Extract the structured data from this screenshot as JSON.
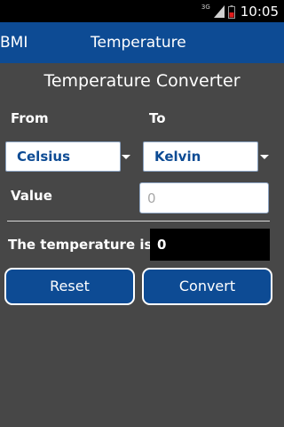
{
  "status_bar": {
    "network": "3G",
    "time": "10:05",
    "signal_icon": "signal-bars-icon",
    "battery_icon": "battery-low-icon",
    "battery_color": "#e11b1b"
  },
  "tabs": [
    {
      "label": "BMI"
    },
    {
      "label": "Temperature"
    }
  ],
  "title": "Temperature Converter",
  "from": {
    "label": "From",
    "selected": "Celsius"
  },
  "to": {
    "label": "To",
    "selected": "Kelvin"
  },
  "value": {
    "label": "Value",
    "placeholder": "0",
    "current": ""
  },
  "result": {
    "label": "The temperature is",
    "value": "0"
  },
  "buttons": {
    "reset": "Reset",
    "convert": "Convert"
  },
  "colors": {
    "accent": "#0d4b94",
    "background": "#474747"
  }
}
